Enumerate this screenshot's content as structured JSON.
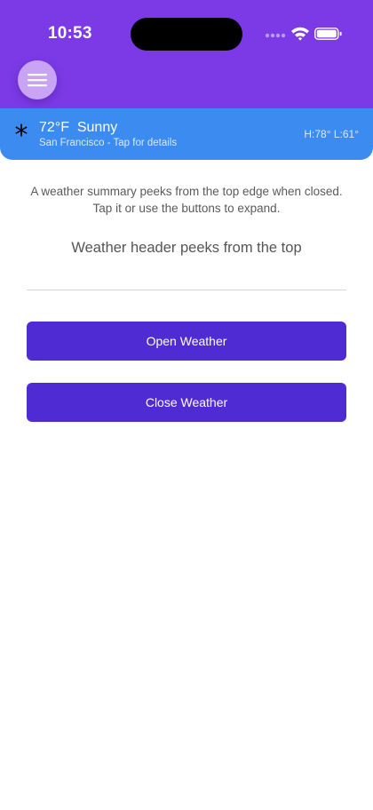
{
  "status_bar": {
    "time": "10:53",
    "icons": [
      "signal-icon",
      "wifi-icon",
      "battery-icon"
    ]
  },
  "colors": {
    "header": "#7b3ae6",
    "weather_card": "#3c8bf0",
    "menu_button": "#c9a4f5",
    "action_button": "#4f2bd3"
  },
  "menu": {
    "icon": "hamburger-icon"
  },
  "weather": {
    "glyph": "*",
    "temp_condition": "72°F  Sunny",
    "subtitle": "San Francisco - Tap for details",
    "high_low": "H:78° L:61°"
  },
  "content": {
    "description": "A weather summary peeks from the top edge when closed. Tap it or use the buttons to expand.",
    "peek_label": "Weather header peeks from the top"
  },
  "buttons": {
    "open_label": "Open Weather",
    "close_label": "Close Weather"
  }
}
